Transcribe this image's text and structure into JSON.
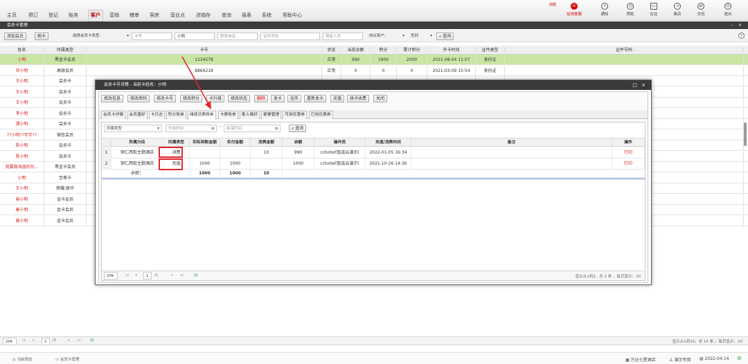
{
  "nav": {
    "items": [
      "主页",
      "预订",
      "登记",
      "账务",
      "客户",
      "营销",
      "稽审",
      "客房",
      "营业点",
      "进销存",
      "查询",
      "报表",
      "系统",
      "帮助中心"
    ],
    "active_index": 4,
    "promo_tag": "加盟",
    "tools": [
      "在线客服",
      "通知",
      "预抵",
      "在住",
      "离店",
      "交班",
      "退出"
    ]
  },
  "title_bar": {
    "title": "会员卡管理",
    "controls": "– ×"
  },
  "toolbar": {
    "add_member": "添加会员",
    "swipe_card": "刷卡",
    "card_type_placeholder": "-选择会员卡类型-",
    "card_no_label": "卡号",
    "name_value": "小明",
    "phone_placeholder": "联系电话",
    "id_placeholder": "证件号码",
    "sales_placeholder": "销售人员",
    "agreement_placeholder": "-协议客户-",
    "gender_placeholder": "性别",
    "search": "查询",
    "help_icon": "?"
  },
  "grid": {
    "headers": [
      "姓名",
      "所属类型",
      "卡号",
      "状态",
      "当前余额",
      "积分",
      "累计积分",
      "开卡时间",
      "证件类型",
      "证件号码"
    ],
    "rows": [
      [
        "小明",
        "黑金卡会员",
        "1234578",
        "正常",
        "990",
        "1900",
        "2000",
        "2021-08-04 11:07",
        "身份证",
        ""
      ],
      [
        "邓小明",
        "高级会员",
        "8866218",
        "正常",
        "0",
        "0",
        "0",
        "2021-03-09 15:54",
        "身份证",
        ""
      ],
      [
        "王小明",
        "会员卡",
        "",
        "",
        "",
        "",
        "",
        "",
        "",
        ""
      ],
      [
        "王小明",
        "会员卡",
        "",
        "",
        "",
        "",
        "",
        "",
        "",
        ""
      ],
      [
        "王小明",
        "会员卡",
        "",
        "",
        "",
        "",
        "",
        "",
        "",
        ""
      ],
      [
        "李小明",
        "会员卡",
        "",
        "",
        "",
        "",
        "",
        "",
        "",
        ""
      ],
      [
        "谭小明",
        "会员卡",
        "",
        "",
        "",
        "",
        "",
        "",
        "",
        ""
      ],
      [
        "??小明??写字??",
        "微信会员",
        "",
        "",
        "",
        "",
        "",
        "",
        "",
        ""
      ],
      [
        "陈小明",
        "会员卡",
        "",
        "",
        "",
        "",
        "",
        "",
        "",
        ""
      ],
      [
        "陈小明",
        "会员卡",
        "",
        "",
        "",
        "",
        "",
        "",
        "",
        ""
      ],
      [
        "我要做海盗的孙...",
        "黑金卡会员",
        "",
        "",
        "",
        "",
        "",
        "",
        "",
        ""
      ],
      [
        "小明",
        "至尊卡",
        "",
        "",
        "",
        "",
        "",
        "",
        "",
        ""
      ],
      [
        "王小明",
        "荣耀,联华",
        "",
        "",
        "",
        "",
        "",
        "",
        "",
        ""
      ],
      [
        "曾小明",
        "金卡会员",
        "",
        "",
        "",
        "",
        "",
        "",
        "",
        ""
      ],
      [
        "秦小明",
        "金卡会员",
        "",
        "",
        "",
        "",
        "",
        "",
        "",
        ""
      ],
      [
        "黄小明",
        "金卡会员",
        "",
        "",
        "",
        "",
        "",
        "",
        "",
        ""
      ]
    ],
    "selected_row": 0
  },
  "bottom_pager": {
    "page_size": "20",
    "page": "1",
    "total_pages": "/1",
    "summary": "显示从1到15，总 15 条 。每页显示：20"
  },
  "status_bar": {
    "current_room": "当前房态",
    "member_mgmt": "会员卡管理",
    "hotel": "万达七星酒店",
    "user": "演示专用",
    "date": "2022-04-14"
  },
  "dialog": {
    "title": "会员卡号详情 - 当前卡姓名：小明",
    "controls": "□ ×",
    "buttons": [
      "修改信息",
      "修改密码",
      "修改卡号",
      "修改积分",
      "卡升级",
      "修改状态",
      "删除",
      "发卡",
      "挂失",
      "重新发卡",
      "充值",
      "续卡收费",
      "关闭"
    ],
    "tabs": [
      "会员卡详情",
      "会员喜好",
      "卡日志",
      "积分账单",
      "储值消费账单",
      "卡费账单",
      "客人偏好",
      "套餐管理",
      "可用优惠券",
      "已用优惠券"
    ],
    "active_tab": 4,
    "filter": {
      "type_placeholder": "所属类型",
      "start_placeholder": "开始时间",
      "end_placeholder": "结束时间",
      "tilde": "~",
      "search": "查询"
    },
    "table": {
      "headers": [
        "所属分店",
        "所属类型",
        "实际到账金额",
        "实付金额",
        "消费金额",
        "余额",
        "操作员",
        "充值/消费时间",
        "备注",
        "操作"
      ],
      "rows": [
        [
          "1",
          "铜仁西街主题酒店",
          "消费",
          "",
          "",
          "10",
          "990",
          "cchotel(智选云演示)",
          "2022-01-05 16:34",
          "",
          "打印"
        ],
        [
          "2",
          "铜仁西街主题酒店",
          "充值",
          "1000",
          "1000",
          "",
          "1000",
          "cchotel(智选云演示)",
          "2021-10-26 14:36",
          "",
          "打印"
        ]
      ],
      "subtotal_label": "小计：",
      "subtotal": [
        "1000",
        "1000",
        "10"
      ]
    },
    "pager": {
      "page_size": "20",
      "page": "1",
      "total_pages": "/1",
      "summary": "显示从1到2，总 2 条 。每页显示：20"
    }
  }
}
